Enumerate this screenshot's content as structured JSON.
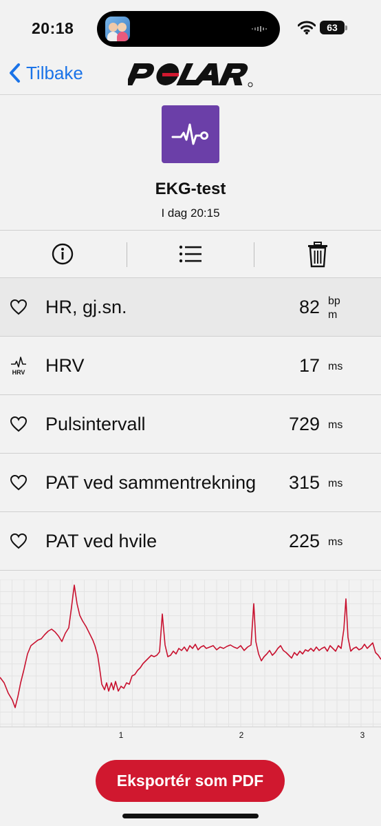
{
  "status_bar": {
    "time": "20:18",
    "battery": "63"
  },
  "nav": {
    "back_label": "Tilbake",
    "logo_text": "POLAR"
  },
  "header": {
    "title": "EKG-test",
    "subtitle": "I dag 20:15"
  },
  "toolbar": {
    "items": [
      "info-icon",
      "list-icon",
      "trash-icon"
    ]
  },
  "metrics": [
    {
      "icon": "heart-outline-icon",
      "label": "HR, gj.sn.",
      "value": "82",
      "unit": "bpm",
      "unit_lines": [
        "bp",
        "m"
      ]
    },
    {
      "icon": "hrv-icon",
      "icon_text": "HRV",
      "label": "HRV",
      "value": "17",
      "unit": "ms"
    },
    {
      "icon": "heart-outline-icon",
      "label": "Pulsintervall",
      "value": "729",
      "unit": "ms"
    },
    {
      "icon": "heart-outline-icon",
      "label": "PAT ved sammentrekning",
      "value": "315",
      "unit": "ms"
    },
    {
      "icon": "heart-outline-icon",
      "label": "PAT ved hvile",
      "value": "225",
      "unit": "ms"
    }
  ],
  "ecg_chart": {
    "x_ticks": [
      "1",
      "2",
      "3"
    ],
    "trace_color": "#c8102e",
    "grid_color": "#e3e3e3"
  },
  "export_button": {
    "label": "Eksportér som PDF"
  },
  "colors": {
    "accent_blue": "#1a73e8",
    "brand_red": "#d0182f",
    "icon_purple": "#6b3fa8"
  }
}
